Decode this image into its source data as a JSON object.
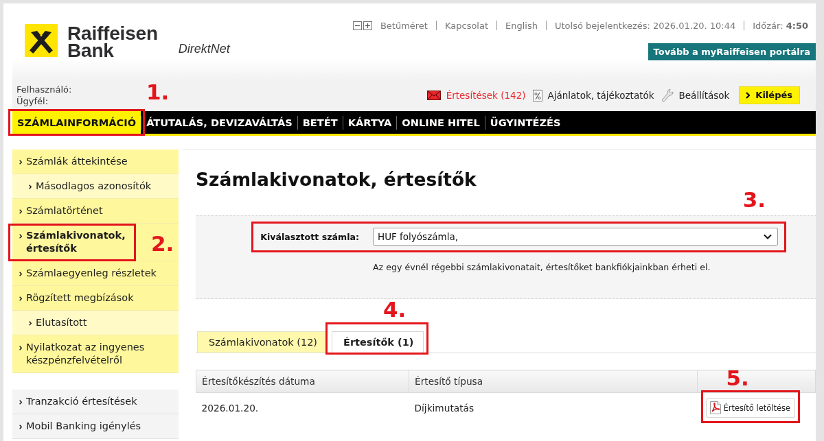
{
  "header": {
    "logo": {
      "lines": [
        "Raiffeisen",
        "Bank"
      ],
      "product": "DirektNet"
    },
    "utility_bar": {
      "font_size_label": "Betűméret",
      "links": [
        "Kapcsolat",
        "English"
      ],
      "last_login": "Utolsó bejelentkezés: 2026.01.20. 10:44",
      "session_timeout": "Időzár: **4:50**"
    },
    "portal_button": "Tovább a myRaiffeisen portálra"
  },
  "user_bar": {
    "user_label": "Felhasználó:",
    "client_label": "Ügyfél:",
    "notifications": "Értesítések (142)",
    "offers": "Ajánlatok, tájékoztatók",
    "settings": "Beállítások",
    "logout": "Kilépés"
  },
  "main_nav": [
    {
      "label": "SZÁMLAINFORMÁCIÓ",
      "selected": true,
      "step": "1."
    },
    {
      "label": "ÁTUTALÁS, DEVIZAVÁLTÁS",
      "selected": false
    },
    {
      "label": "BETÉT",
      "selected": false
    },
    {
      "label": "KÁRTYA",
      "selected": false
    },
    {
      "label": "ONLINE HITEL",
      "selected": false
    },
    {
      "label": "ÜGYINTÉZÉS",
      "selected": false
    }
  ],
  "sidebar": {
    "menu": [
      {
        "label": "Számlák áttekintése",
        "selected": false,
        "children": [
          {
            "label": "Másodlagos azonosítók",
            "selected": false
          }
        ]
      },
      {
        "label": "Számlatörténet",
        "selected": false
      },
      {
        "label": "Számlakivonatok, értesítők",
        "selected": true,
        "step": "2."
      },
      {
        "label": "Számlaegyenleg részletek",
        "selected": false
      },
      {
        "label": "Rögzített megbízások",
        "selected": false,
        "children": [
          {
            "label": "Elutasított",
            "selected": false
          }
        ]
      },
      {
        "label": "Nyilatkozat az ingyenes készpénzfelvételről",
        "selected": false
      }
    ],
    "extra_menu": [
      {
        "label": "Tranzakció értesítések",
        "selected": false
      },
      {
        "label": "Mobil Banking igénylés",
        "selected": false
      }
    ]
  },
  "page": {
    "title": "Számlakivonatok, értesítők",
    "account_select": {
      "label": "Kiválasztott számla:",
      "value": "HUF folyószámla,",
      "step": "3."
    },
    "note": "Az egy évnél régebbi számlakivonatait, értesítőket bankfiókjainkban érheti el.",
    "tabs": [
      {
        "label": "Számlakivonatok (12)",
        "selected": false
      },
      {
        "label": "Értesítők (1)",
        "selected": true,
        "step": "4."
      }
    ],
    "table": {
      "columns": [
        "Értesítőkészítés dátuma",
        "Értesítő típusa"
      ],
      "rows": [
        {
          "date": "2026.01.20.",
          "type": "Díjkimutatás",
          "action": {
            "label": "Értesítő letöltése",
            "step": "5."
          }
        }
      ]
    }
  }
}
